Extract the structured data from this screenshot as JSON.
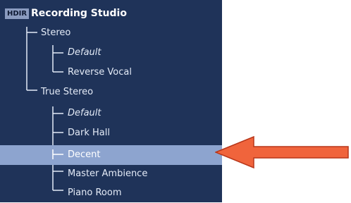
{
  "header": {
    "badge": "HDIR",
    "title": "Recording Studio"
  },
  "groups": [
    {
      "label": "Stereo",
      "items": [
        "Default",
        "Reverse Vocal"
      ]
    },
    {
      "label": "True Stereo",
      "items": [
        "Default",
        "Dark Hall",
        "Decent",
        "Master Ambience",
        "Piano Room"
      ]
    }
  ],
  "selected_item": "Decent",
  "colors": {
    "panel": "#1f3359",
    "selection": "#8da4cf",
    "arrow": "#f0643c"
  }
}
